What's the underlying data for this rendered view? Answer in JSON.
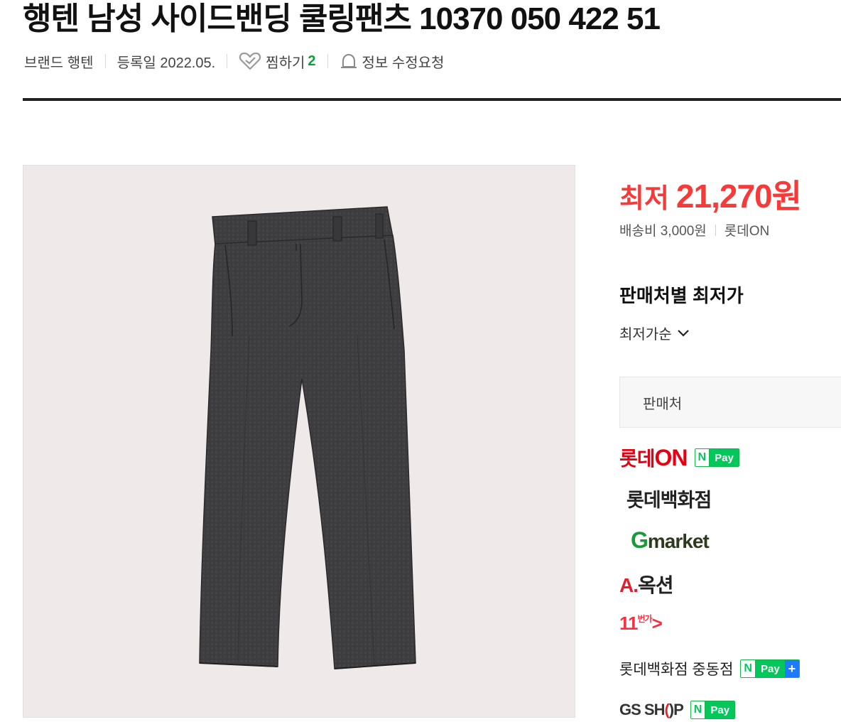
{
  "product": {
    "title": "행텐 남성 사이드밴딩 쿨링팬츠 10370 050 422 51",
    "brand_label": "브랜드 행텐",
    "reg_date_label": "등록일 2022.05.",
    "wish_label": "찜하기",
    "wish_count": "2",
    "report_label": "정보 수정요청"
  },
  "price": {
    "lowest_label": "최저",
    "lowest_value": "21,270원",
    "shipping": "배송비 3,000원",
    "lowest_seller": "롯데ON"
  },
  "sellers_section": {
    "title": "판매처별 최저가",
    "sort_label": "최저가순",
    "header_label": "판매처",
    "sellers": [
      {
        "name_a": "롯데",
        "name_b": "ON",
        "npay": "Pay"
      },
      {
        "name": "롯데백화점"
      },
      {
        "name_a": "G",
        "name_b": "market"
      },
      {
        "name_a": "A.",
        "name_b": "옥션"
      },
      {
        "name_a": "11",
        "name_b": "번가"
      },
      {
        "name": "롯데백화점 중동점",
        "npay": "Pay",
        "plus": "+"
      },
      {
        "name_a": "GS SH",
        "name_b": "(",
        "name_c": ")P",
        "npay": "Pay"
      }
    ],
    "npay_n": "N"
  },
  "colors": {
    "price_red": "#f53a3a",
    "npay_green": "#03c75a",
    "image_bg": "#efe9e9"
  }
}
